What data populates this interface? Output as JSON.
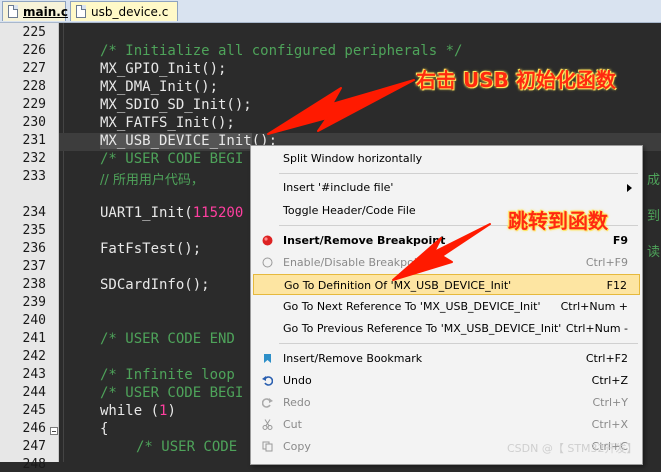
{
  "tabs": [
    {
      "label": "main.c",
      "active": true
    },
    {
      "label": "usb_device.c",
      "active": false
    }
  ],
  "line_numbers": [
    "225",
    "226",
    "227",
    "228",
    "229",
    "230",
    "231",
    "232",
    "233",
    "234",
    "235",
    "236",
    "237",
    "238",
    "239",
    "240",
    "241",
    "242",
    "243",
    "244",
    "245",
    "246",
    "247",
    "248"
  ],
  "code": {
    "l226": "/* Initialize all configured peripherals */",
    "l227": "MX_GPIO_Init();",
    "l228": "MX_DMA_Init();",
    "l229": "MX_SDIO_SD_Init();",
    "l230": "MX_FATFS_Init();",
    "l231_word": "MX_USB_DEVICE_Init",
    "l231_rest": "();",
    "l232": "/* USER CODE BEGI",
    "l233": "// 所用用户代码，",
    "l235_a": "UART1_Init(",
    "l235_num": "115200",
    "l237": "FatFsTest();",
    "l239": "SDCardInfo();",
    "l242": "/* USER CODE END",
    "l244": "/* Infinite loop",
    "l245": "/* USER CODE BEGI",
    "l246_a": "while (",
    "l246_num": "1",
    "l246_b": ")",
    "l247": "{",
    "l248": "/* USER CODE",
    "r233": "成",
    "r235": "到",
    "r237": "读"
  },
  "menu": {
    "split": "Split Window horizontally",
    "insert_include": "Insert '#include file'",
    "toggle_header": "Toggle Header/Code File",
    "insert_breakpoint": "Insert/Remove Breakpoint",
    "insert_breakpoint_sc": "F9",
    "enable_breakpoint": "Enable/Disable Breakpoint",
    "enable_breakpoint_sc": "Ctrl+F9",
    "goto_def": "Go To Definition Of 'MX_USB_DEVICE_Init'",
    "goto_def_sc": "F12",
    "next_ref": "Go To Next Reference To 'MX_USB_DEVICE_Init'",
    "next_ref_sc": "Ctrl+Num +",
    "prev_ref": "Go To Previous Reference To 'MX_USB_DEVICE_Init'",
    "prev_ref_sc": "Ctrl+Num -",
    "bookmark": "Insert/Remove Bookmark",
    "bookmark_sc": "Ctrl+F2",
    "undo": "Undo",
    "undo_sc": "Ctrl+Z",
    "redo": "Redo",
    "redo_sc": "Ctrl+Y",
    "cut": "Cut",
    "cut_sc": "Ctrl+X",
    "copy": "Copy",
    "copy_sc": "Ctrl+C"
  },
  "annotations": {
    "right_click": "右击 USB 初始化函数",
    "jump": "跳转到函数"
  },
  "watermark": "CSDN @【  STM32开发】",
  "colors": {
    "editor_bg": "#2b2b2b",
    "comment": "#4ea35a",
    "number": "#ff3fa0",
    "annotation": "#ff2a10",
    "menu_highlight": "#fde5a2"
  }
}
